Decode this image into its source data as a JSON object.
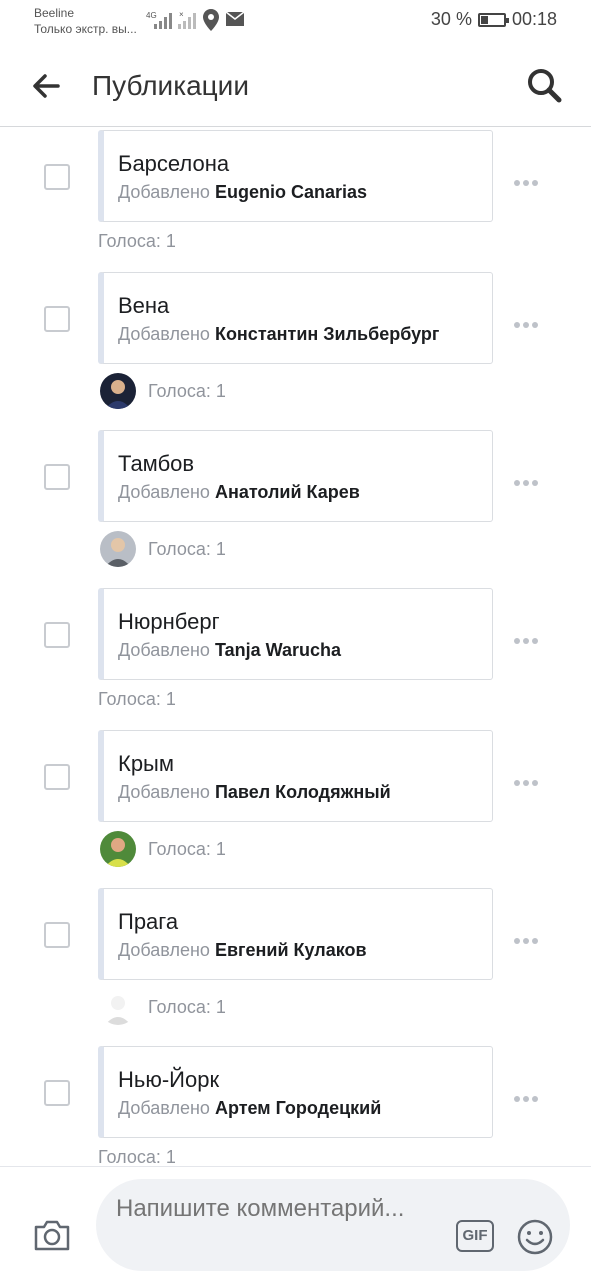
{
  "status_bar": {
    "carrier": "Beeline",
    "carrier_note": "Только экстр. вы...",
    "network": "4G",
    "battery": "30 %",
    "battery_level": 0.3,
    "time": "00:18"
  },
  "header": {
    "title": "Публикации",
    "back_icon": "arrow-left-icon",
    "search_icon": "search-icon"
  },
  "items": [
    {
      "title": "Барселона",
      "added_label": "Добавлено",
      "author": "Eugenio Canarias",
      "votes": "Голоса: 1",
      "has_avatar": false
    },
    {
      "title": "Вена",
      "added_label": "Добавлено",
      "author": "Константин Зильбербург",
      "votes": "Голоса: 1",
      "has_avatar": true
    },
    {
      "title": "Тамбов",
      "added_label": "Добавлено",
      "author": "Анатолий Карев",
      "votes": "Голоса: 1",
      "has_avatar": true
    },
    {
      "title": "Нюрнберг",
      "added_label": "Добавлено",
      "author": "Tanja Warucha",
      "votes": "Голоса: 1",
      "has_avatar": false
    },
    {
      "title": "Крым",
      "added_label": "Добавлено",
      "author": "Павел Колодяжный",
      "votes": "Голоса: 1",
      "has_avatar": true
    },
    {
      "title": "Прага",
      "added_label": "Добавлено",
      "author": "Евгений Кулаков",
      "votes": "Голоса: 1",
      "has_avatar": true
    },
    {
      "title": "Нью-Йорк",
      "added_label": "Добавлено",
      "author": "Артем Городецкий",
      "votes": "Голоса: 1",
      "has_avatar": false
    }
  ],
  "composer": {
    "placeholder": "Напишите комментарий...",
    "gif_label": "GIF",
    "camera_icon": "camera-icon",
    "emoji_icon": "emoji-icon"
  },
  "colors": {
    "card_accent": "#dde3ee",
    "muted_text": "#90949c",
    "input_bg": "#f0f2f5"
  }
}
